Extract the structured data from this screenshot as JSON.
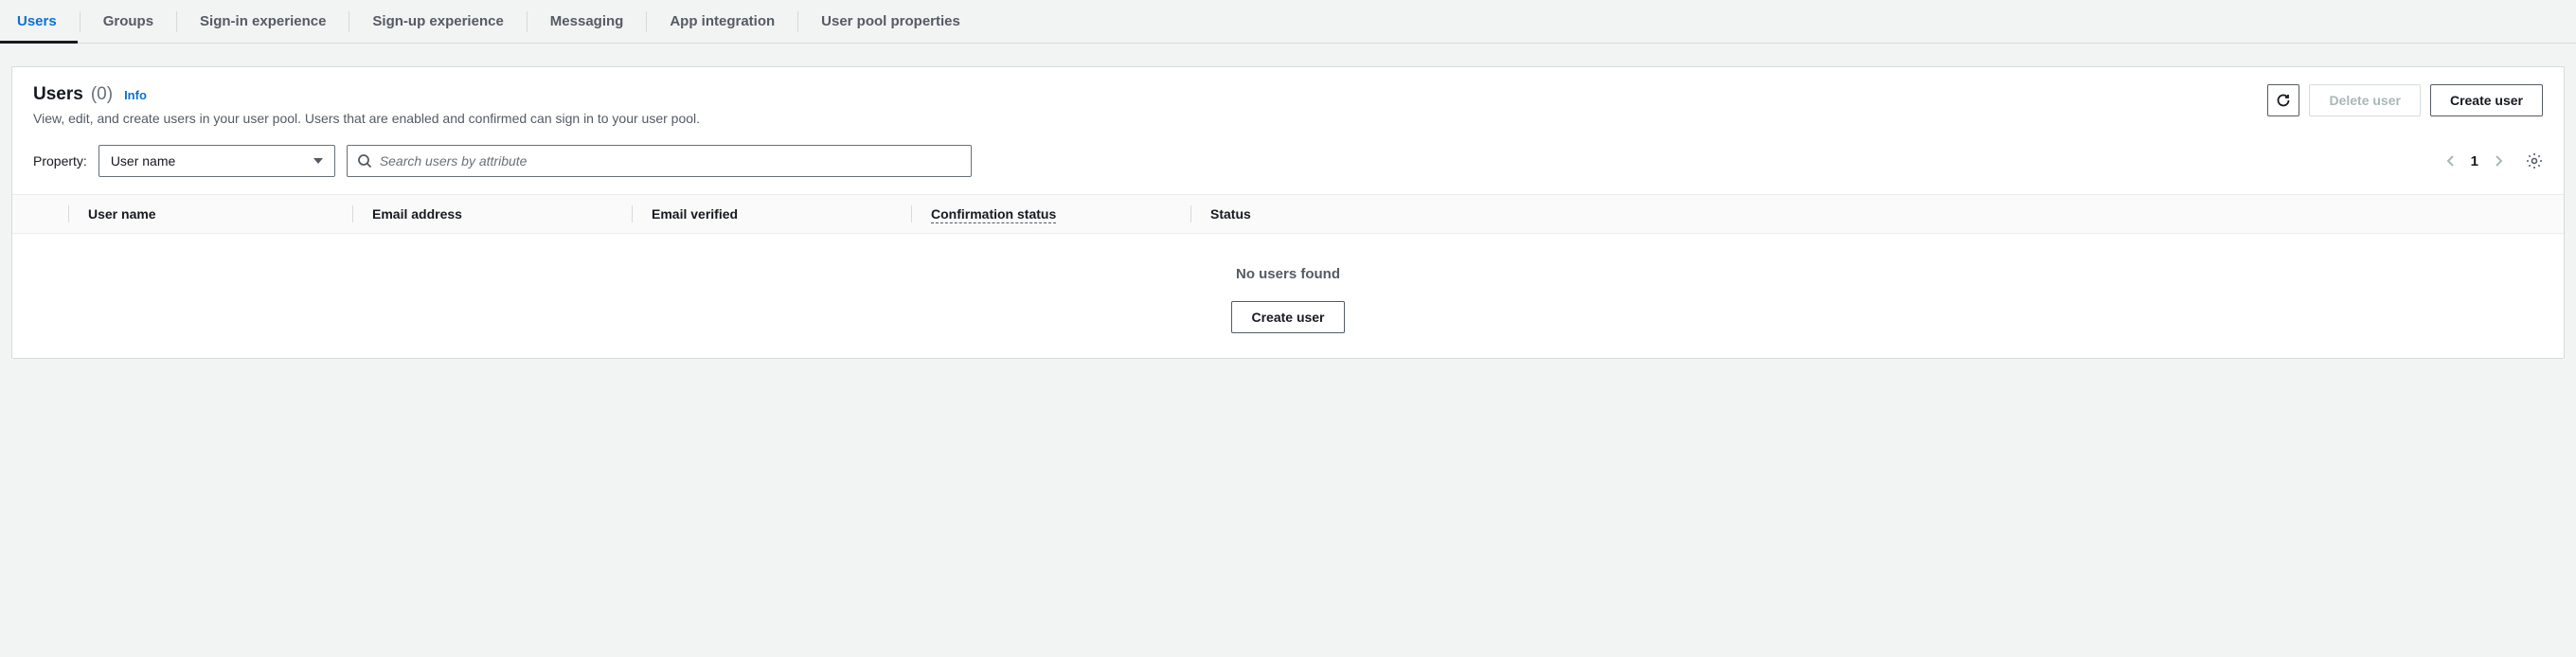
{
  "tabs": [
    {
      "label": "Users",
      "active": true
    },
    {
      "label": "Groups",
      "active": false
    },
    {
      "label": "Sign-in experience",
      "active": false
    },
    {
      "label": "Sign-up experience",
      "active": false
    },
    {
      "label": "Messaging",
      "active": false
    },
    {
      "label": "App integration",
      "active": false
    },
    {
      "label": "User pool properties",
      "active": false
    }
  ],
  "panel": {
    "title": "Users",
    "count": "(0)",
    "info": "Info",
    "subtitle": "View, edit, and create users in your user pool. Users that are enabled and confirmed can sign in to your user pool."
  },
  "actions": {
    "delete": "Delete user",
    "create": "Create user"
  },
  "filter": {
    "property_label": "Property:",
    "selected": "User name",
    "search_placeholder": "Search users by attribute"
  },
  "pagination": {
    "page": "1"
  },
  "columns": {
    "username": "User name",
    "email": "Email address",
    "verified": "Email verified",
    "confirmation": "Confirmation status",
    "status": "Status"
  },
  "empty": {
    "message": "No users found",
    "action": "Create user"
  }
}
